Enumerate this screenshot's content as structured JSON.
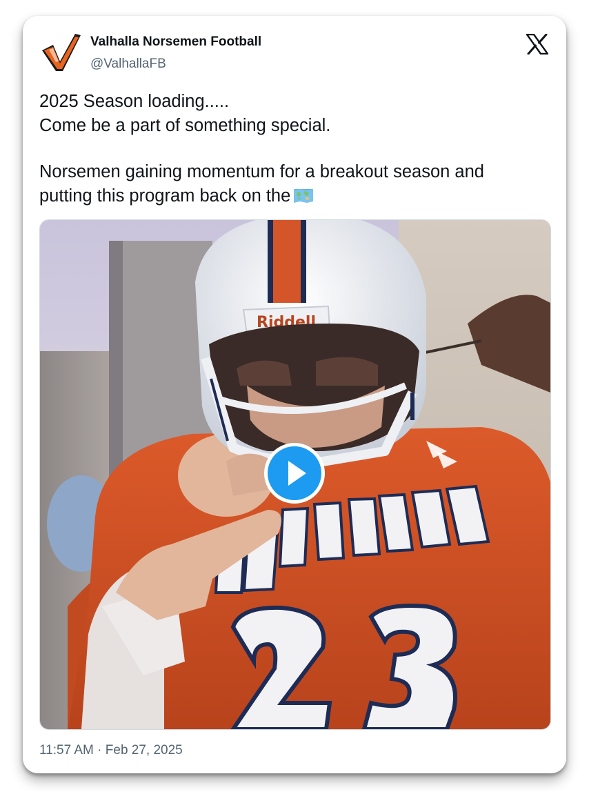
{
  "account": {
    "display_name": "Valhalla Norsemen Football",
    "handle": "@ValhallaFB",
    "avatar_icon": "norsemen-v-logo-icon",
    "brand_color": "#e8641e"
  },
  "platform": {
    "logo_icon": "x-logo-icon"
  },
  "tweet": {
    "line1": "2025 Season loading.....",
    "line2": "Come be a part of something special.",
    "line3": "Norsemen gaining momentum for a breakout season and",
    "line4": "putting this program back on the",
    "line4_emoji": "world-map-emoji"
  },
  "media": {
    "type": "video",
    "play_icon": "play-icon",
    "play_color": "#1d9bf0",
    "jersey_text": "VALHALLA",
    "jersey_number": "23",
    "helmet_brand": "Riddell"
  },
  "meta": {
    "time": "11:57 AM",
    "separator": "·",
    "date": "Feb 27, 2025"
  }
}
